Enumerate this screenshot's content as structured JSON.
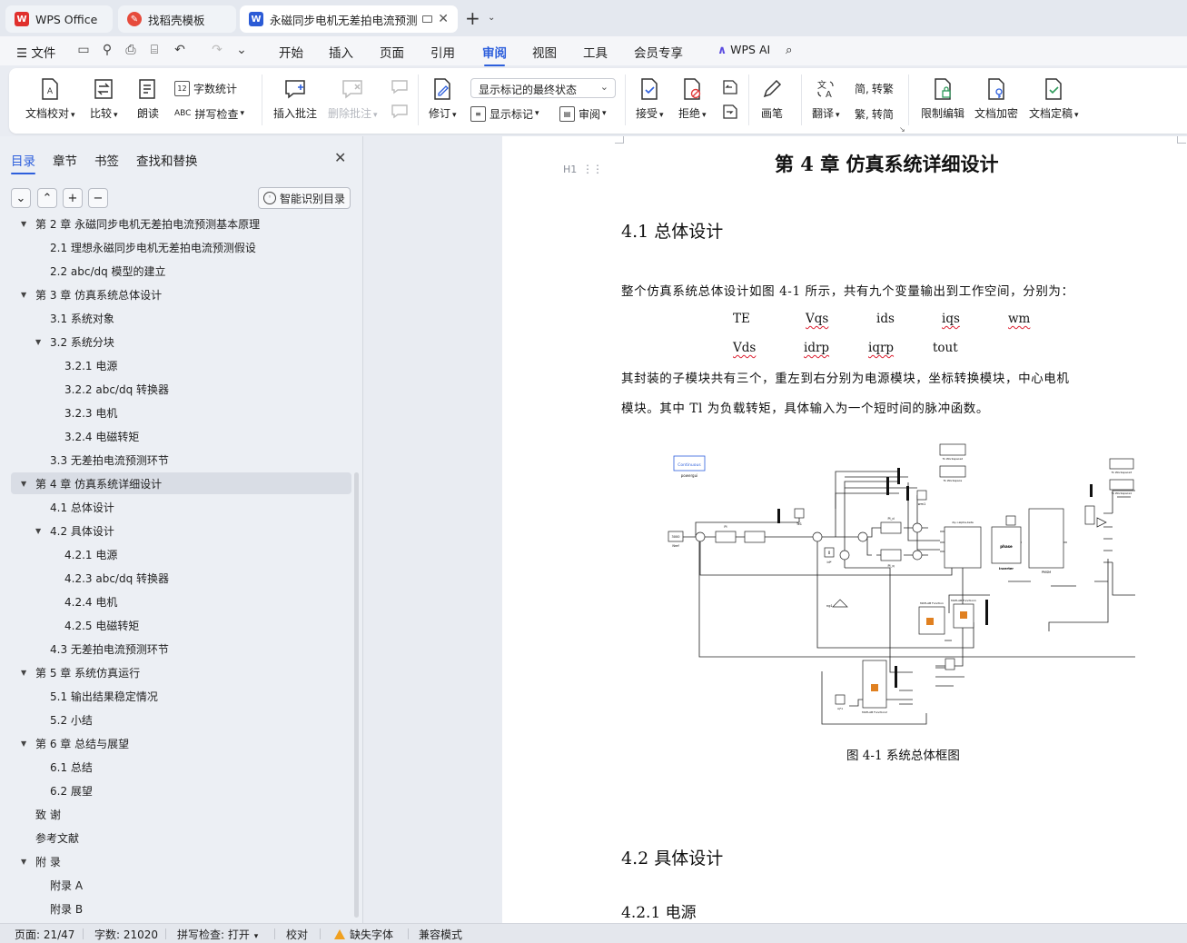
{
  "tabs": [
    {
      "label": "WPS Office",
      "icon": "wps-logo-icon"
    },
    {
      "label": "找稻壳模板",
      "icon": "docer-icon"
    },
    {
      "label": "永磁同步电机无差拍电流预测",
      "icon": "word-doc-icon",
      "active": true
    }
  ],
  "menu": {
    "file": "文件",
    "items": [
      "开始",
      "插入",
      "页面",
      "引用",
      "审阅",
      "视图",
      "工具",
      "会员专享"
    ],
    "active": "审阅",
    "ai": "WPS AI"
  },
  "ribbon": {
    "doc_check": "文档校对",
    "compare": "比较",
    "read_aloud": "朗读",
    "word_count": "字数统计",
    "spell_check": "拼写检查",
    "insert_comment": "插入批注",
    "delete_comment": "删除批注",
    "revise": "修订",
    "markup_state": "显示标记的最终状态",
    "show_markup": "显示标记",
    "review_pane": "审阅",
    "accept": "接受",
    "reject": "拒绝",
    "draw": "画笔",
    "translate": "翻译",
    "to_traditional": "转繁",
    "to_simplified": "转简",
    "restrict_edit": "限制编辑",
    "encrypt": "文档加密",
    "finalize": "文档定稿"
  },
  "nav": {
    "tabs": [
      "目录",
      "章节",
      "书签",
      "查找和替换"
    ],
    "active_tab": "目录",
    "smart_toc": "智能识别目录",
    "toc": [
      {
        "text": "第 2 章  永磁同步电机无差拍电流预测基本原理",
        "level": 1,
        "expanded": true
      },
      {
        "text": "2.1 理想永磁同步电机无差拍电流预测假设",
        "level": 2
      },
      {
        "text": "2.2 abc/dq 模型的建立",
        "level": 2
      },
      {
        "text": "第 3 章  仿真系统总体设计",
        "level": 1,
        "expanded": true
      },
      {
        "text": "3.1 系统对象",
        "level": 2
      },
      {
        "text": "3.2 系统分块",
        "level": 2,
        "expanded": true
      },
      {
        "text": "3.2.1 电源",
        "level": 3
      },
      {
        "text": "3.2.2 abc/dq 转换器",
        "level": 3
      },
      {
        "text": "3.2.3 电机",
        "level": 3
      },
      {
        "text": "3.2.4 电磁转矩",
        "level": 3
      },
      {
        "text": "3.3 无差拍电流预测环节",
        "level": 2
      },
      {
        "text": "第 4 章  仿真系统详细设计",
        "level": 1,
        "expanded": true,
        "selected": true
      },
      {
        "text": "4.1 总体设计",
        "level": 2
      },
      {
        "text": "4.2 具体设计",
        "level": 2,
        "expanded": true
      },
      {
        "text": "4.2.1 电源",
        "level": 3
      },
      {
        "text": "4.2.3 abc/dq 转换器",
        "level": 3
      },
      {
        "text": "4.2.4 电机",
        "level": 3
      },
      {
        "text": "4.2.5 电磁转矩",
        "level": 3
      },
      {
        "text": "4.3 无差拍电流预测环节",
        "level": 2
      },
      {
        "text": "第 5 章  系统仿真运行",
        "level": 1,
        "expanded": true
      },
      {
        "text": "5.1 输出结果稳定情况",
        "level": 2
      },
      {
        "text": "5.2 小结",
        "level": 2
      },
      {
        "text": "第 6 章  总结与展望",
        "level": 1,
        "expanded": true
      },
      {
        "text": "6.1 总结",
        "level": 2
      },
      {
        "text": "6.2 展望",
        "level": 2
      },
      {
        "text": "致   谢",
        "level": 1
      },
      {
        "text": "参考文献",
        "level": 1
      },
      {
        "text": "附   录",
        "level": 1,
        "expanded": true
      },
      {
        "text": "附录 A",
        "level": 2
      },
      {
        "text": "附录 B",
        "level": 2
      }
    ]
  },
  "document": {
    "heading_marker": "H1",
    "chapter_title": "第 4 章  仿真系统详细设计",
    "section_41": "4.1 总体设计",
    "para1": "整个仿真系统总体设计如图 4-1 所示，共有九个变量输出到工作空间，分别为：",
    "vars_row1": [
      "TE",
      "Vqs",
      "ids",
      "iqs",
      "wm"
    ],
    "vars_row2": [
      "Vds",
      "idrp",
      "iqrp",
      "tout"
    ],
    "para2_line1": "其封装的子模块共有三个，重左到右分别为电源模块，坐标转换模块，中心电机",
    "para2_line2": "模块。其中 Tl 为负载转矩，具体输入为一个短时间的脉冲函数。",
    "figure_caption": "图 4-1 系统总体框图",
    "section_42": "4.2 具体设计",
    "section_421": "4.2.1 电源",
    "diagram_labels": {
      "continuous": "Continuous",
      "powergui": "powergui",
      "step": "3000",
      "step_name": "Nref",
      "pi": "PI",
      "pi_d": "PI_d",
      "pi_q": "PI_q",
      "gain": "ng1",
      "zero": "0",
      "id_ref": "id*",
      "te": "Te1",
      "wm": "wm1",
      "ws1": "To Workspace2",
      "ws2": "To Workspace",
      "ws3": "To Workspace3",
      "ws4": "To Workspace1",
      "tl": "Tl",
      "dq_abc": "dq->alpha,beta",
      "inverter": "Inverter",
      "pmsm": "PMSM",
      "phase": "phase",
      "mf": "MATLAB Function",
      "mf1": "MATLAB Function1",
      "mf2": "MATLAB Function2",
      "iq_ref": "iq*1"
    }
  },
  "status": {
    "page": "页面: 21/47",
    "words": "字数: 21020",
    "spell": "拼写检查: 打开",
    "proof": "校对",
    "missing_font": "缺失字体",
    "compat": "兼容模式"
  },
  "colors": {
    "accent": "#2d5fdc",
    "wps_red": "#e0302d",
    "word_blue": "#2b5bd6",
    "warning": "#f0a020"
  }
}
